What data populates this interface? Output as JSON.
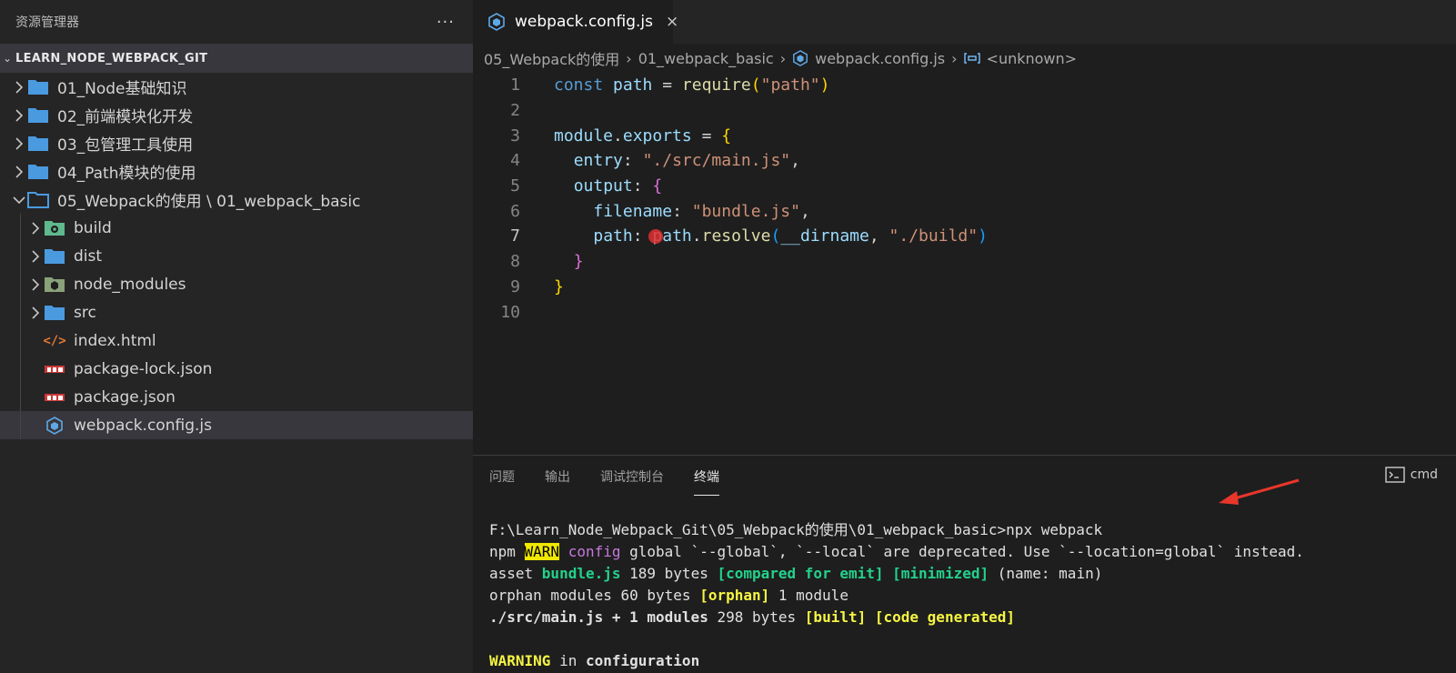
{
  "sidebar": {
    "title": "资源管理器",
    "more": "···",
    "root": "LEARN_NODE_WEBPACK_GIT",
    "items": [
      {
        "label": "01_Node基础知识"
      },
      {
        "label": "02_前端模块化开发"
      },
      {
        "label": "03_包管理工具使用"
      },
      {
        "label": "04_Path模块的使用"
      },
      {
        "label": "05_Webpack的使用 \\ 01_webpack_basic"
      },
      {
        "label": "build"
      },
      {
        "label": "dist"
      },
      {
        "label": "node_modules"
      },
      {
        "label": "src"
      },
      {
        "label": "index.html"
      },
      {
        "label": "package-lock.json"
      },
      {
        "label": "package.json"
      },
      {
        "label": "webpack.config.js"
      }
    ]
  },
  "editor": {
    "tab_label": "webpack.config.js",
    "tab_close": "×",
    "breadcrumb": [
      "05_Webpack的使用",
      "01_webpack_basic",
      "webpack.config.js",
      "<unknown>"
    ],
    "line_numbers": [
      "1",
      "2",
      "3",
      "4",
      "5",
      "6",
      "7",
      "8",
      "9",
      "10"
    ],
    "code": {
      "l1_const": "const",
      "l1_path": "path",
      "l1_eq": " = ",
      "l1_req": "require",
      "l1_arg": "\"path\"",
      "l3_module": "module",
      "l3_exports": "exports",
      "l4_key": "entry",
      "l4_val": "\"./src/main.js\"",
      "l5_key": "output",
      "l6_key": "filename",
      "l6_val": "\"bundle.js\"",
      "l7_key": "path",
      "l7_obj": "path",
      "l7_fn": "resolve",
      "l7_dir": "__dirname",
      "l7_val": "\"./build\""
    }
  },
  "panel": {
    "tabs": [
      "问题",
      "输出",
      "调试控制台",
      "终端"
    ],
    "terminal_label": "cmd",
    "terminal": {
      "prompt": "F:\\Learn_Node_Webpack_Git\\05_Webpack的使用\\01_webpack_basic>npx webpack",
      "npm": "npm ",
      "warn": "WARN",
      "config": "config",
      "warn_text": " global `--global`, `--local` are deprecated. Use `--location=global` instead.",
      "asset": "asset ",
      "bundle": "bundle.js",
      "asset_size": " 189 bytes ",
      "compared": "[compared for emit]",
      "minimized": "[minimized]",
      "name_main": " (name: main)",
      "orphan_pre": "orphan modules 60 bytes ",
      "orphan_tag": "[orphan]",
      "orphan_post": " 1 module",
      "main_js": "./src/main.js + 1 modules",
      "main_size": " 298 bytes ",
      "built": "[built]",
      "code_generated": "[code generated]",
      "warning": "WARNING",
      "in_word": " in ",
      "configuration": "configuration"
    }
  },
  "colors": {
    "accent_folder": "#4a9ae0",
    "webpack_blue": "#5fa8e6",
    "npm_red": "#cb3837",
    "arrow_red": "#e8362a"
  }
}
